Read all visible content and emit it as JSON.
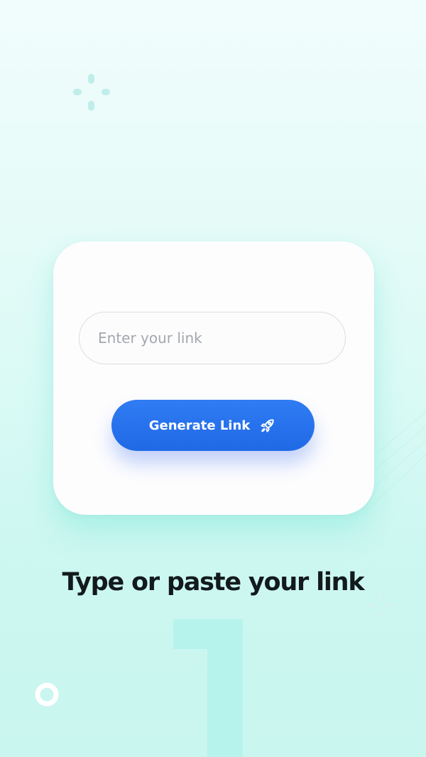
{
  "form": {
    "link_placeholder": "Enter your link",
    "link_value": "",
    "generate_label": "Generate Link"
  },
  "headline": "Type or paste your link",
  "step_number": 1,
  "icons": {
    "button": "rocket-icon",
    "decorations": [
      "sparkle-icon",
      "ring-icon"
    ]
  },
  "colors": {
    "background": "#dafaf5",
    "card": "#fdfdfe",
    "accent": "#2a72ee",
    "headline": "#121a1c",
    "numeral": "#b6f3ec",
    "placeholder": "#a3a7ad"
  }
}
